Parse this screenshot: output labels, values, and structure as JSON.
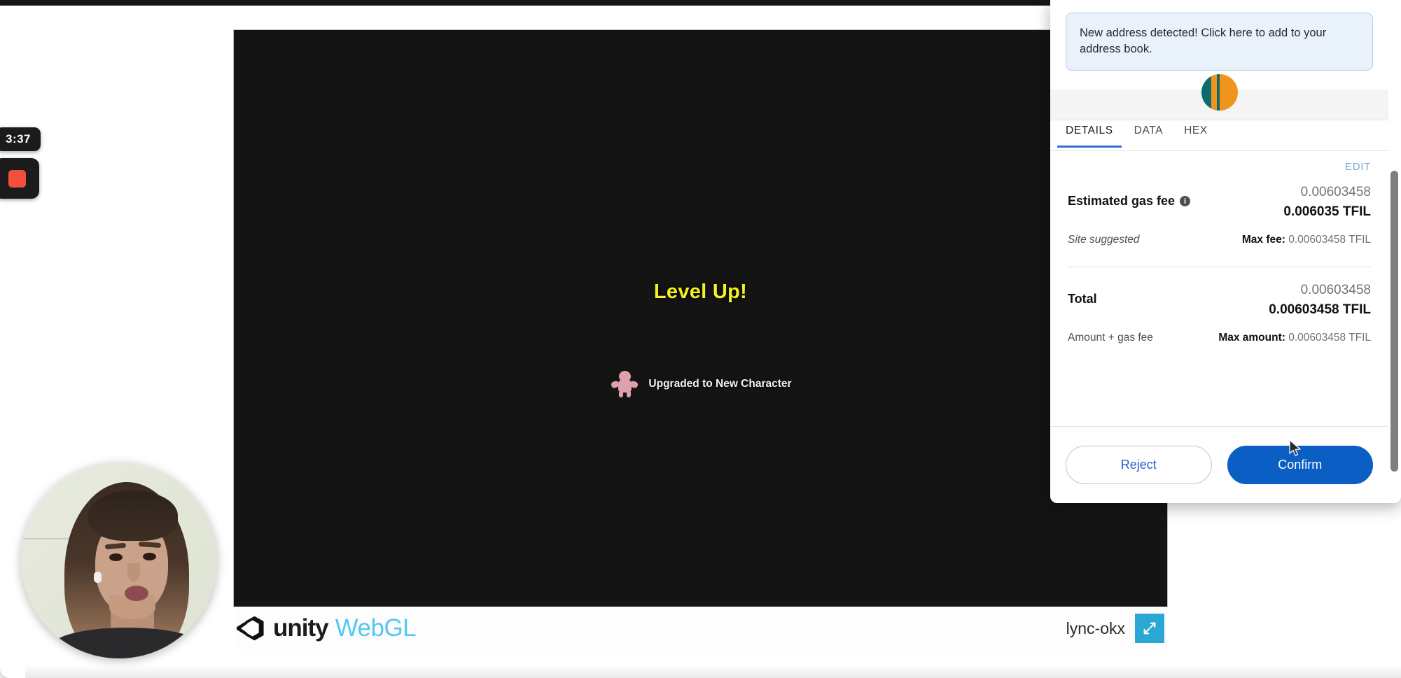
{
  "recorder": {
    "timer": "3:37",
    "stop_label": "stop-recording"
  },
  "game": {
    "level_up_text": "Level Up!",
    "upgrade_text": "Upgraded to New Character",
    "footer": {
      "unity_word": "unity",
      "webgl_word": "WebGL",
      "build_title": "lync-okx",
      "fullscreen_label": "fullscreen"
    }
  },
  "metamask": {
    "alert": "New address detected! Click here to add to your address book.",
    "tabs": [
      {
        "label": "DETAILS",
        "active": true
      },
      {
        "label": "DATA",
        "active": false
      },
      {
        "label": "HEX",
        "active": false
      }
    ],
    "edit_label": "EDIT",
    "gas": {
      "label": "Estimated gas fee",
      "info_glyph": "i",
      "fiat": "0.00603458",
      "native": "0.006035 TFIL",
      "source": "Site suggested",
      "max_label": "Max fee:",
      "max_value": "0.00603458 TFIL"
    },
    "total": {
      "label": "Total",
      "fiat": "0.00603458",
      "native": "0.00603458 TFIL",
      "source": "Amount + gas fee",
      "max_label": "Max amount:",
      "max_value": "0.00603458 TFIL"
    },
    "buttons": {
      "reject": "Reject",
      "confirm": "Confirm"
    }
  },
  "colors": {
    "accent_blue": "#0b5fc4",
    "link_blue": "#1f5fc4",
    "alert_bg": "#e9f1fb",
    "alert_border": "#b7cfe8",
    "level_up_yellow": "#f5f021",
    "unity_cyan": "#54c8f0",
    "fullscreen_teal": "#2ba7d4",
    "record_red": "#f2503a",
    "canvas_black": "#141414"
  }
}
